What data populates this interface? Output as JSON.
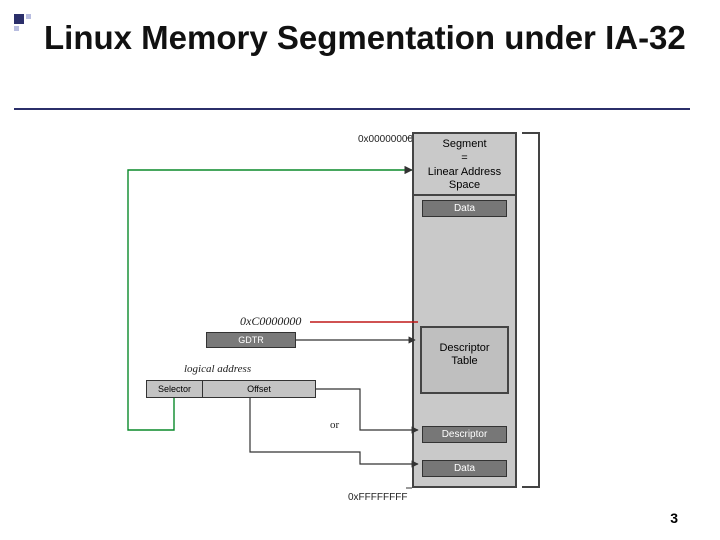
{
  "title": "Linux Memory Segmentation under IA-32",
  "page_number": "3",
  "diagram": {
    "addr_top": "0x00000000",
    "addr_bottom": "0xFFFFFFFF",
    "segment_header_l1": "Segment",
    "segment_header_l2": "=",
    "segment_header_l3": "Linear Address",
    "segment_header_l4": "Space",
    "data_chip": "Data",
    "desc_table_l1": "Descriptor",
    "desc_table_l2": "Table",
    "descriptor_chip": "Descriptor",
    "gdtr": "GDTR",
    "c0_addr": "0xC0000000",
    "logical_address_label": "logical address",
    "selector": "Selector",
    "offset": "Offset",
    "or_label": "or"
  }
}
